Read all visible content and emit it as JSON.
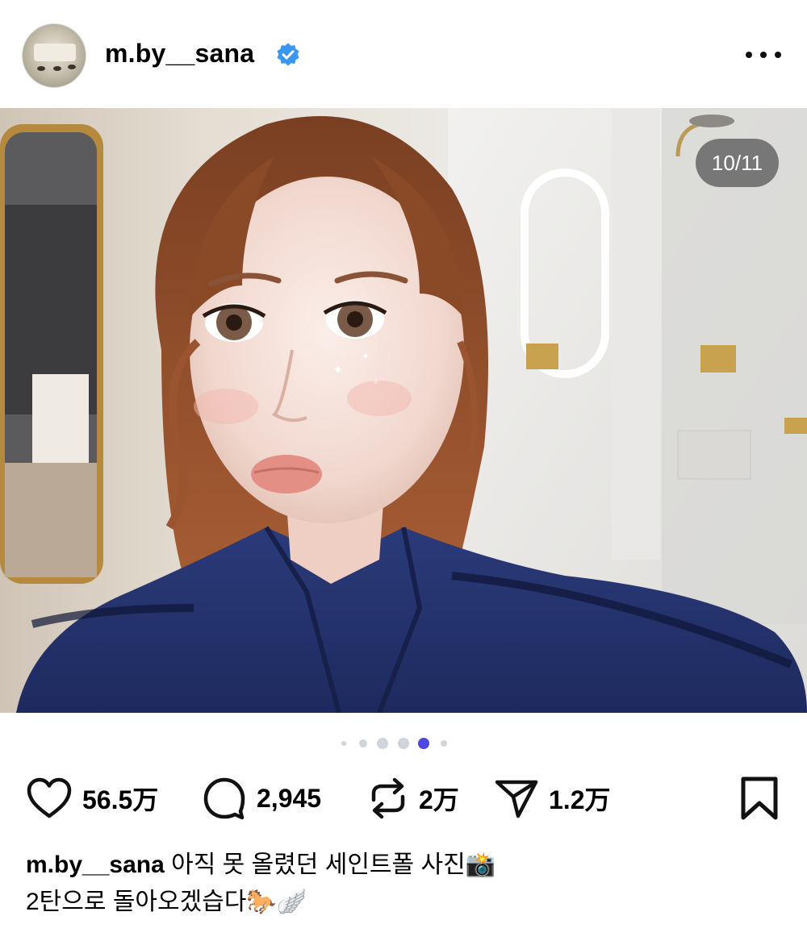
{
  "post": {
    "username": "m.by__sana",
    "verified": true,
    "counter": "10/11",
    "carousel": {
      "total": 6,
      "active_index": 4
    }
  },
  "actions": {
    "likes": "56.5万",
    "comments": "2,945",
    "reposts": "2万",
    "shares": "1.2万"
  },
  "caption": {
    "username": "m.by__sana",
    "line1": "아직 못 올렸던 세인트폴 사진📸",
    "line2": "2탄으로 돌아오겠습다🐎🪽"
  },
  "icons": {
    "verified": "verified-badge-icon",
    "more": "more-options-icon",
    "like": "heart-icon",
    "comment": "comment-bubble-icon",
    "repost": "repost-icon",
    "share": "paper-plane-icon",
    "save": "bookmark-icon"
  },
  "colors": {
    "verified": "#3897f0",
    "dot_active": "#4f46e5",
    "dot_inactive": "#d1d5db"
  }
}
